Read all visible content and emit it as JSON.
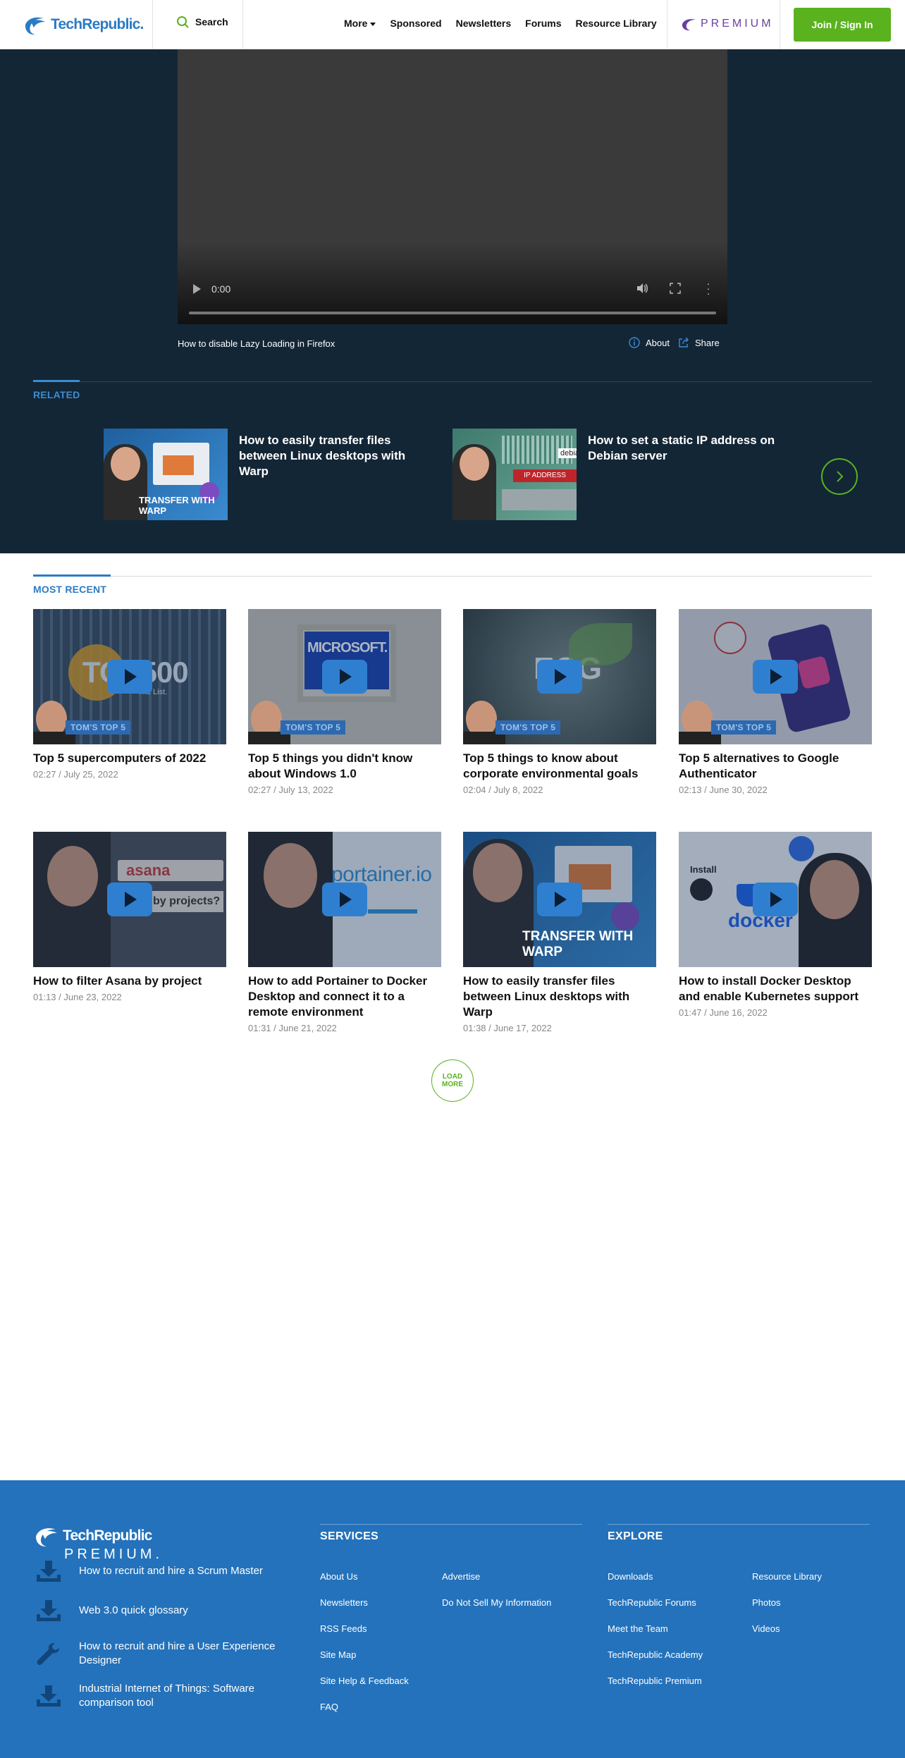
{
  "header": {
    "logo_text": "TechRepublic.",
    "search_label": "Search",
    "nav": [
      "More",
      "Sponsored",
      "Newsletters",
      "Forums",
      "Resource Library"
    ],
    "premium_label": "PREMIUM",
    "join_label": "Join / Sign In"
  },
  "video": {
    "time": "0:00",
    "title": "How to disable Lazy Loading in Firefox",
    "about_label": "About",
    "share_label": "Share"
  },
  "related": {
    "label": "RELATED",
    "items": [
      {
        "title": "How to easily transfer files between Linux desktops with Warp",
        "thumb_text": "TRANSFER WITH WARP"
      },
      {
        "title": "How to set a static IP address on Debian server",
        "thumb_text": "IP ADDRESS",
        "thumb_brand": "debian"
      }
    ]
  },
  "most_recent": {
    "label": "MOST RECENT",
    "items": [
      {
        "title": "Top 5 supercomputers of 2022",
        "meta": "02:27 / July 25, 2022",
        "tag": "TOM'S TOP 5",
        "thumb_text": "TOP500",
        "thumb_sub": "The List."
      },
      {
        "title": "Top 5 things you didn't know about Windows 1.0",
        "meta": "02:27 / July 13, 2022",
        "tag": "TOM'S TOP 5",
        "thumb_text": "MICROSOFT."
      },
      {
        "title": "Top 5 things to know about corporate environmental goals",
        "meta": "02:04 / July 8, 2022",
        "tag": "TOM'S TOP 5",
        "thumb_text": "ESG"
      },
      {
        "title": "Top 5 alternatives to Google Authenticator",
        "meta": "02:13 / June 30, 2022",
        "tag": "TOM'S TOP 5",
        "thumb_text": ""
      },
      {
        "title": "How to filter Asana by project",
        "meta": "01:13 / June 23, 2022",
        "thumb_text": "asana",
        "thumb_sub": "by projects?"
      },
      {
        "title": "How to add Portainer to Docker Desktop and connect it to a remote environment",
        "meta": "01:31 / June 21, 2022",
        "thumb_text": "portainer.io"
      },
      {
        "title": "How to easily transfer files between Linux desktops with Warp",
        "meta": "01:38 / June 17, 2022",
        "thumb_text": "TRANSFER WITH WARP"
      },
      {
        "title": "How to install Docker Desktop and enable Kubernetes support",
        "meta": "01:47 / June 16, 2022",
        "thumb_text": "docker",
        "thumb_sub": "Install"
      }
    ],
    "load_more": "LOAD MORE"
  },
  "footer": {
    "logo_line1": "TechRepublic",
    "logo_line2": "PREMIUM.",
    "resources": [
      {
        "icon": "download-icon",
        "text": "How to recruit and hire a Scrum Master"
      },
      {
        "icon": "download-icon",
        "text": "Web 3.0 quick glossary"
      },
      {
        "icon": "wrench-icon",
        "text": "How to recruit and hire a User Experience Designer"
      },
      {
        "icon": "download-icon",
        "text": "Industrial Internet of Things: Software comparison tool"
      }
    ],
    "services_head": "SERVICES",
    "services_col1": [
      "About Us",
      "Newsletters",
      "RSS Feeds",
      "Site Map",
      "Site Help & Feedback",
      "FAQ"
    ],
    "services_col2": [
      "Advertise",
      "Do Not Sell My Information"
    ],
    "explore_head": "EXPLORE",
    "explore_col1": [
      "Downloads",
      "TechRepublic Forums",
      "Meet the Team",
      "TechRepublic Academy",
      "TechRepublic Premium"
    ],
    "explore_col2": [
      "Resource Library",
      "Photos",
      "Videos"
    ]
  },
  "colors": {
    "brand_blue": "#2b7bc4",
    "hero_bg": "#132636",
    "accent_green": "#5ab21f",
    "footer_bg": "#2472bb",
    "premium_purple": "#6a3fa0"
  }
}
